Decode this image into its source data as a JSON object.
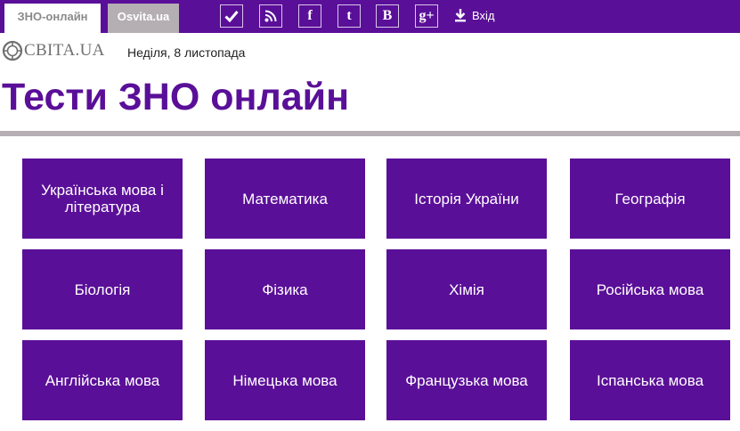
{
  "topbar": {
    "tabs": [
      {
        "label": "ЗНО-онлайн"
      },
      {
        "label": "Osvita.ua"
      }
    ],
    "social_icons": [
      "check-icon",
      "rss-icon",
      "facebook-icon",
      "twitter-icon",
      "vkontakte-icon",
      "google-plus-icon"
    ],
    "social_text": {
      "facebook": "f",
      "twitter": "t",
      "vkontakte": "B",
      "google_plus": "g+"
    },
    "login_label": "Вхід"
  },
  "header": {
    "logo_text": "СВІТА.UA",
    "date": "Неділя, 8 листопада",
    "title": "Тести ЗНО онлайн"
  },
  "subjects": [
    "Українська мова і література",
    "Математика",
    "Історія України",
    "Географія",
    "Біологія",
    "Фізика",
    "Хімія",
    "Російська мова",
    "Англійська мова",
    "Німецька мова",
    "Французька мова",
    "Іспанська мова"
  ],
  "colors": {
    "accent": "#5a0f98",
    "grey": "#b5aeb3",
    "white": "#ffffff"
  }
}
